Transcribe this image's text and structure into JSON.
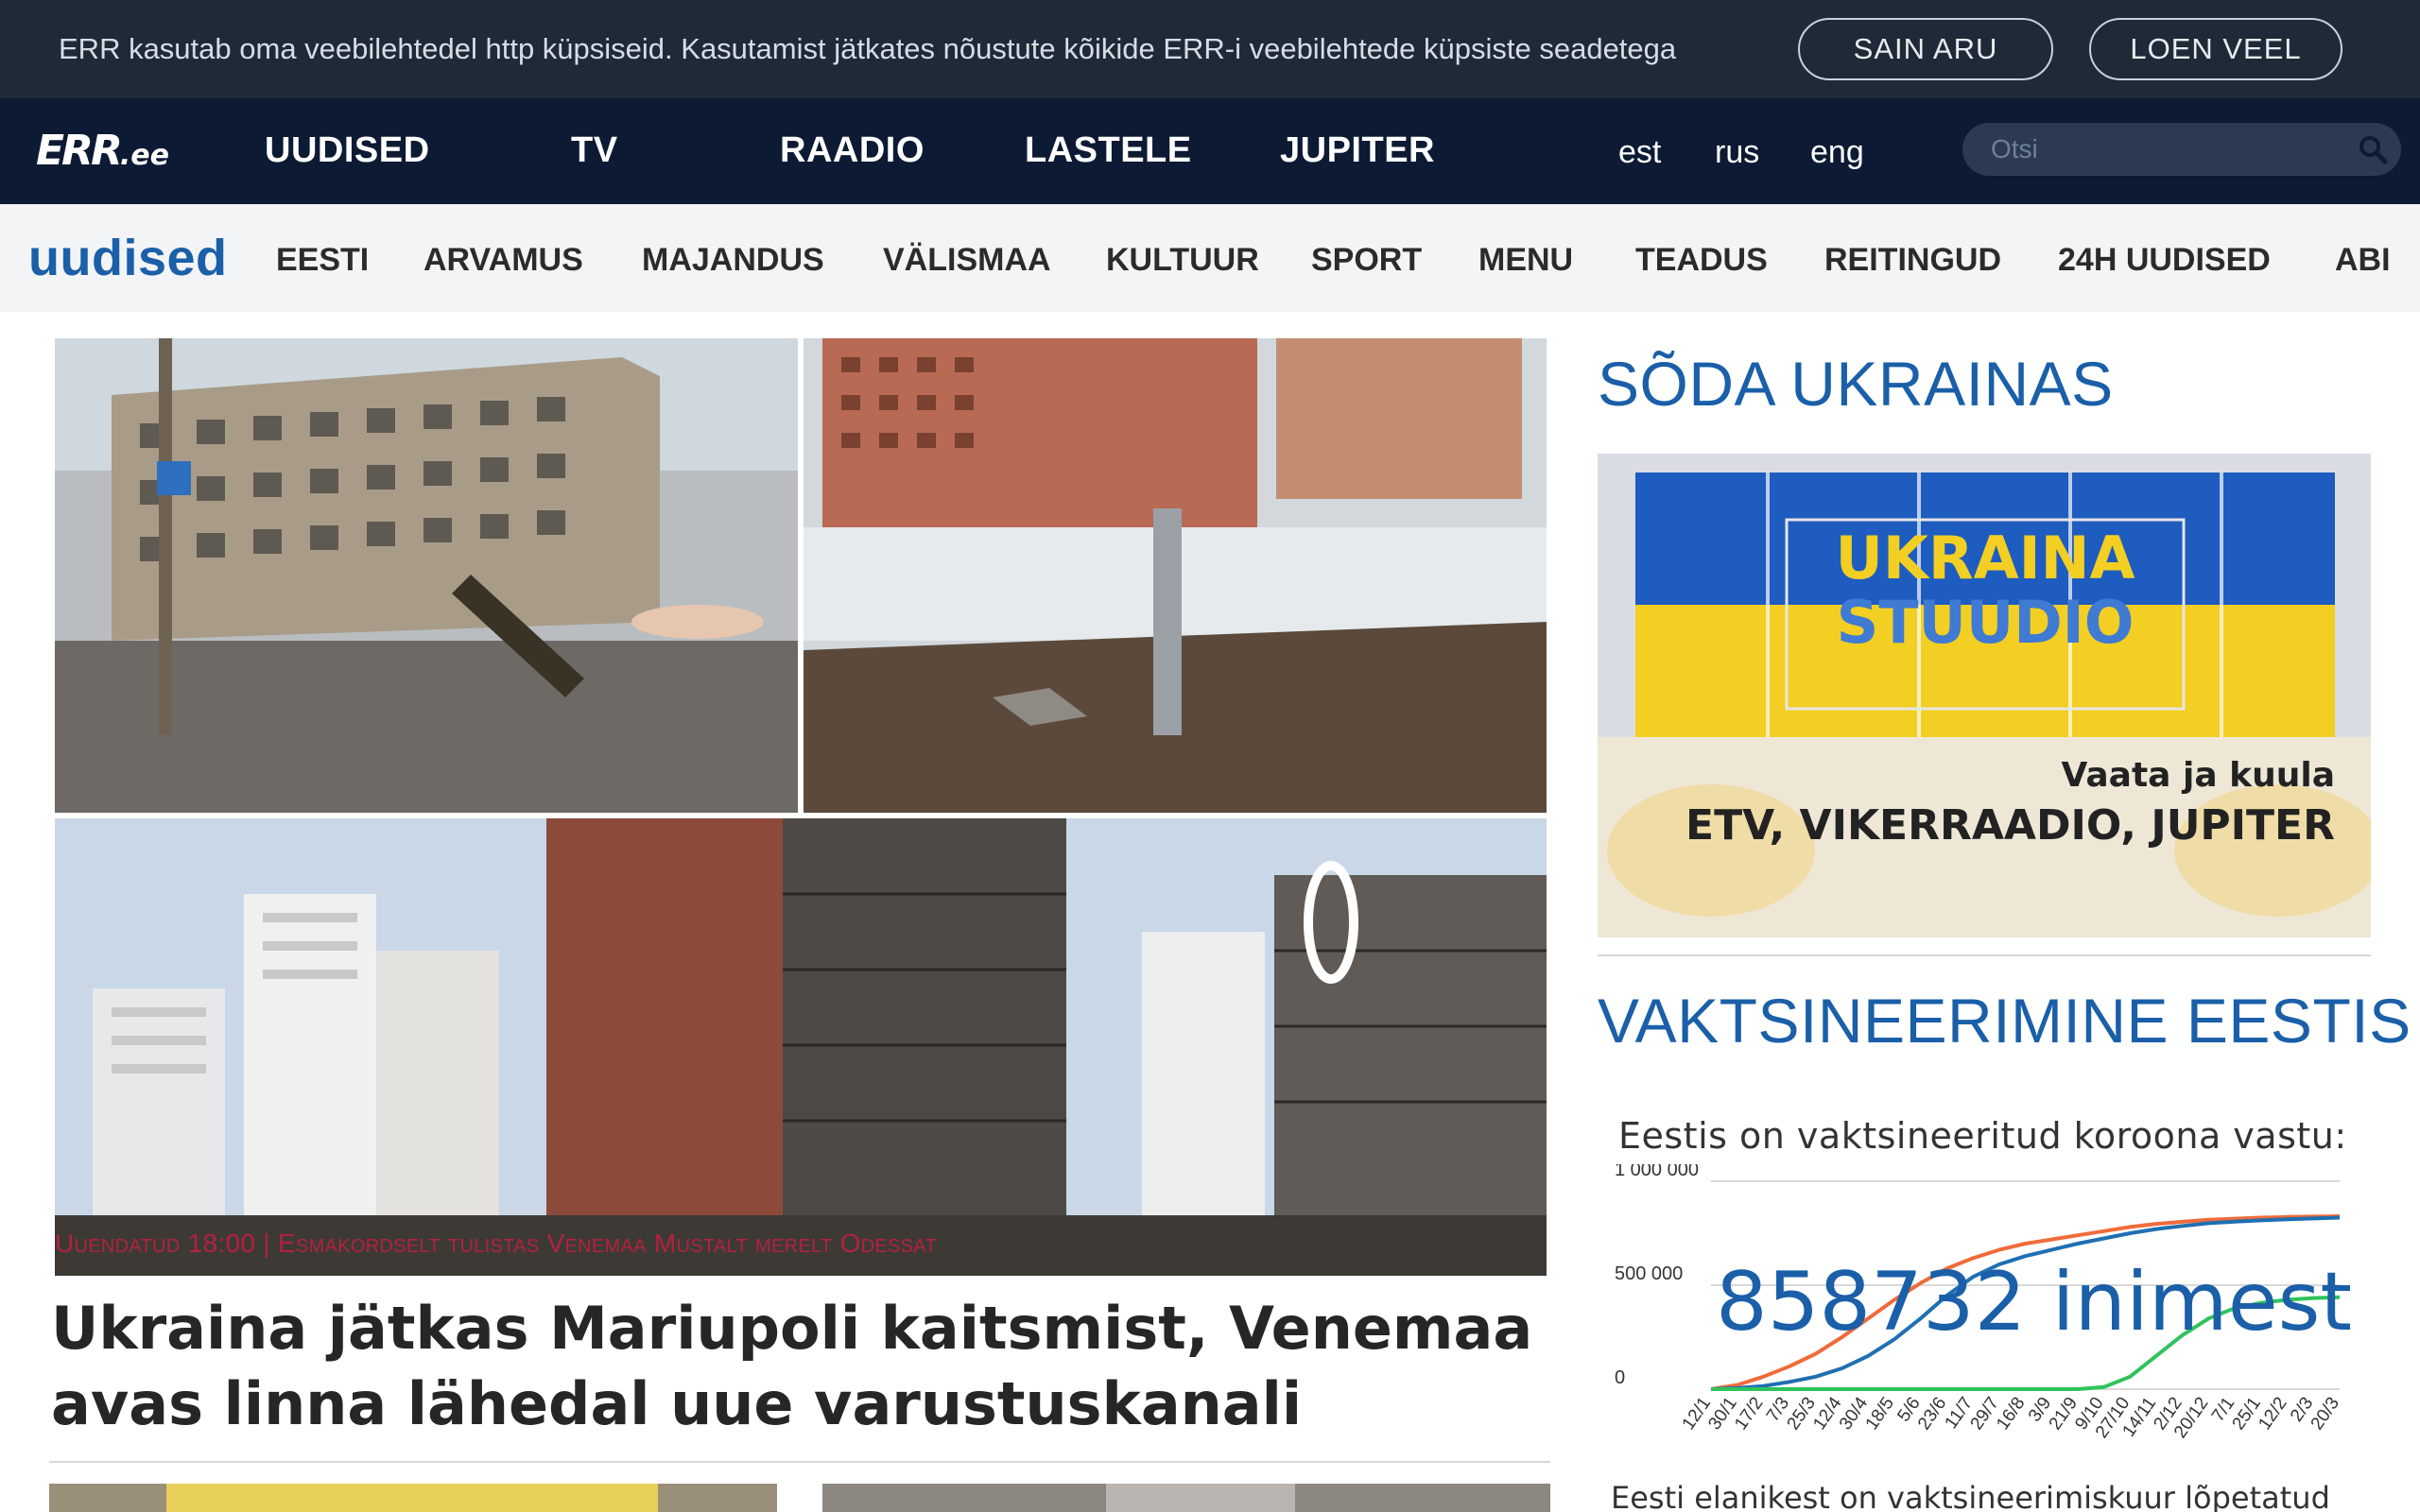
{
  "cookie": {
    "text": "ERR kasutab oma veebilehtedel http küpsiseid. Kasutamist jätkates nõustute kõikide ERR-i veebilehtede küpsiste seadetega",
    "accept_label": "SAIN ARU",
    "more_label": "LOEN VEEL"
  },
  "header": {
    "logo_mark": "ERR",
    "logo_tld": ".ee",
    "nav": [
      "UUDISED",
      "TV",
      "RAADIO",
      "LASTELE",
      "JUPITER"
    ],
    "languages": [
      "est",
      "rus",
      "eng"
    ],
    "search_placeholder": "Otsi"
  },
  "section": {
    "title": "uudised",
    "items": [
      "EESTI",
      "ARVAMUS",
      "MAJANDUS",
      "VÄLISMAA",
      "KULTUUR",
      "SPORT",
      "MENU",
      "TEADUS",
      "REITINGUD",
      "24H UUDISED",
      "ABI"
    ]
  },
  "hero": {
    "caption": "Uuendatud 18:00 | Esmakordselt tulistas Venemaa Mustalt merelt Odessat",
    "headline": "Ukraina jätkas Mariupoli kaitsmist, Venemaa avas linna lähedal uue varustuskanali"
  },
  "sidebar": {
    "war_heading": "SÕDA UKRAINAS",
    "banner": {
      "title_line1": "UKRAINA",
      "title_line2": "STUUDIO",
      "tagline": "Vaata ja kuula",
      "channels": "ETV, VIKERRAADIO, JUPITER"
    },
    "vax_heading": "VAKTSINEERIMINE EESTIS",
    "vax_subtitle": "Eestis on vaktsineeritud koroona vastu:",
    "vax_count": "858732 inimest",
    "vax_bottom": "Eesti elanikest on vaktsineerimiskuur lõpetatud"
  },
  "colors": {
    "accent": "#1a5fa8",
    "dark_nav": "#0c1a33",
    "cookie_bg": "#1f2a38",
    "caption_red": "#b4213c",
    "series_first_dose": "#f06b3a",
    "series_completed": "#1f6fb2",
    "series_booster": "#2fc35c"
  },
  "chart_data": {
    "type": "line",
    "y_tick_labels": [
      "1 000 000",
      "500 000",
      "0"
    ],
    "ylim": [
      0,
      1000000
    ],
    "x": [
      "12/1",
      "30/1",
      "17/2",
      "7/3",
      "25/3",
      "12/4",
      "30/4",
      "18/5",
      "5/6",
      "23/6",
      "11/7",
      "29/7",
      "16/8",
      "3/9",
      "21/9",
      "9/10",
      "27/10",
      "14/11",
      "2/12",
      "20/12",
      "7/1",
      "25/1",
      "12/2",
      "2/3",
      "20/3"
    ],
    "series": [
      {
        "color": "#f06b3a",
        "values": [
          0,
          20000,
          60000,
          110000,
          170000,
          250000,
          340000,
          430000,
          510000,
          580000,
          630000,
          670000,
          700000,
          720000,
          740000,
          760000,
          780000,
          795000,
          805000,
          815000,
          820000,
          825000,
          828000,
          830000,
          832000
        ]
      },
      {
        "color": "#1f6fb2",
        "values": [
          0,
          5000,
          15000,
          35000,
          60000,
          100000,
          160000,
          240000,
          340000,
          450000,
          540000,
          600000,
          640000,
          670000,
          700000,
          725000,
          750000,
          770000,
          785000,
          798000,
          806000,
          812000,
          817000,
          821000,
          825000
        ]
      },
      {
        "color": "#2fc35c",
        "values": [
          0,
          0,
          0,
          0,
          0,
          0,
          0,
          0,
          0,
          0,
          0,
          0,
          0,
          0,
          0,
          10000,
          60000,
          160000,
          260000,
          340000,
          390000,
          415000,
          430000,
          438000,
          442000
        ]
      }
    ],
    "annotation": "858732 inimest",
    "grid": true
  }
}
